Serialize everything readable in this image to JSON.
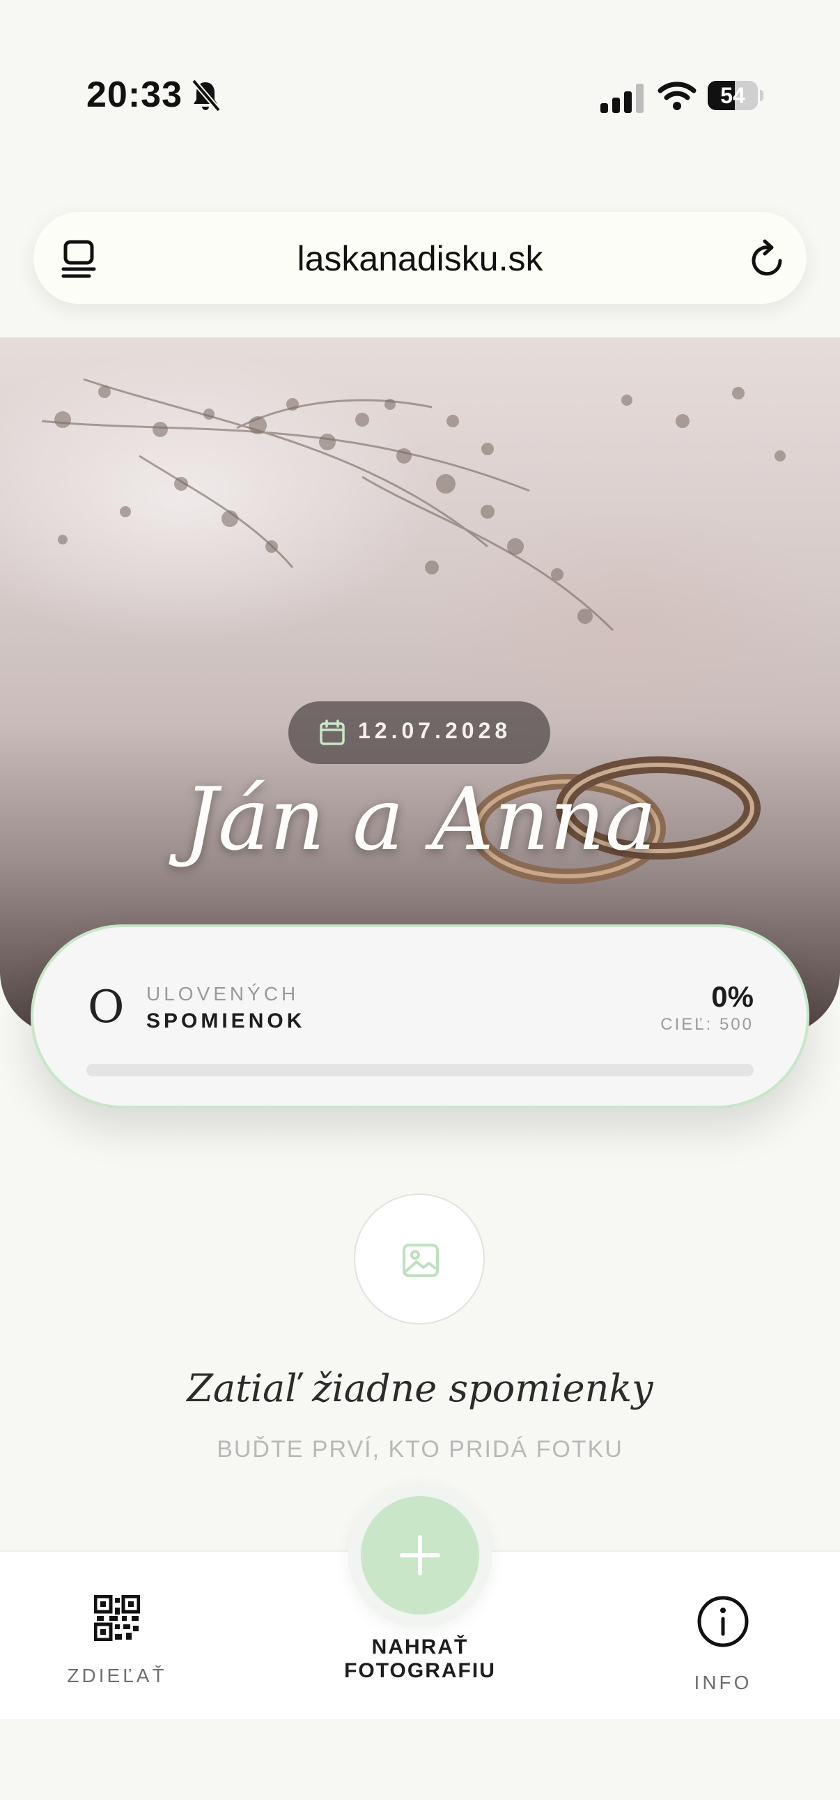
{
  "status_bar": {
    "time": "20:33",
    "battery": "54",
    "battery_level": 0.54,
    "icons": [
      "bell-slash-icon",
      "cellular-signal-icon",
      "wifi-icon",
      "battery-icon"
    ]
  },
  "browser": {
    "url": "laskanadisku.sk",
    "icons": [
      "tabs-icon",
      "reload-icon"
    ]
  },
  "hero": {
    "date": "12.07.2028",
    "names": "Ján a Anna",
    "icons": [
      "calendar-icon"
    ]
  },
  "progress": {
    "initial": "O",
    "label_line1": "ULOVENÝCH",
    "label_line2": "SPOMIENOK",
    "percent": "0%",
    "goal": "CIEĽ: 500",
    "fraction": 0,
    "colors": {
      "border": "#c8e6c9",
      "fill": "#a8d5a9"
    }
  },
  "empty_state": {
    "title": "Zatiaľ žiadne spomienky",
    "subtitle": "BUĎTE PRVÍ, KTO PRIDÁ FOTKU",
    "icon": "image-icon"
  },
  "bottom_nav": {
    "share_label": "ZDIEĽAŤ",
    "upload_label": "NAHRAŤ FOTOGRAFIU",
    "info_label": "INFO",
    "icons": [
      "qr-code-icon",
      "plus-icon",
      "info-icon"
    ],
    "accent": "#c9e6c9"
  }
}
